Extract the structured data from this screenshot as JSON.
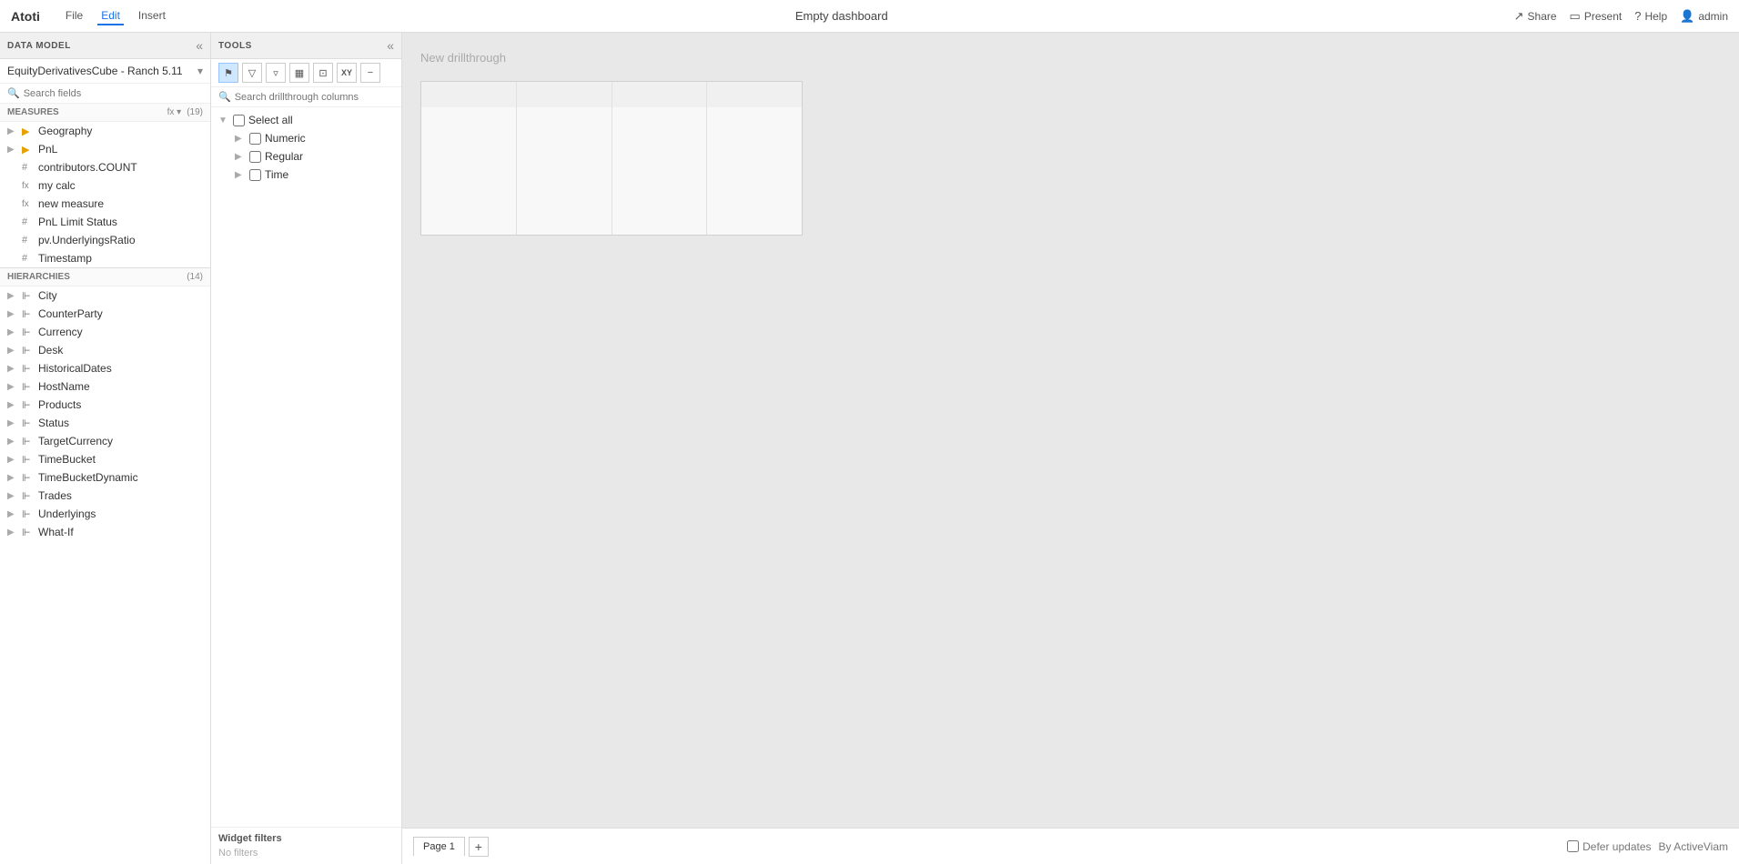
{
  "app": {
    "brand": "Atoti",
    "title": "Empty dashboard"
  },
  "topbar": {
    "menu": [
      "File",
      "Edit",
      "Insert"
    ],
    "active_menu": "Edit",
    "right_actions": [
      "Share",
      "Present",
      "Help",
      "admin"
    ]
  },
  "left_sidebar": {
    "section_title": "DATA MODEL",
    "cube": {
      "name": "EquityDerivativesCube",
      "version": "Ranch 5.11"
    },
    "search_placeholder": "Search fields",
    "measures": {
      "title": "MEASURES",
      "count": "19",
      "items": [
        {
          "type": "folder",
          "icon": "folder",
          "label": "Geography",
          "expandable": true
        },
        {
          "type": "folder",
          "icon": "folder",
          "label": "PnL",
          "expandable": true
        },
        {
          "type": "count",
          "icon": "#",
          "label": "contributors.COUNT"
        },
        {
          "type": "fx",
          "icon": "fx",
          "label": "my calc"
        },
        {
          "type": "fx",
          "icon": "fx",
          "label": "new measure"
        },
        {
          "type": "count",
          "icon": "#",
          "label": "PnL Limit Status"
        },
        {
          "type": "count",
          "icon": "#",
          "label": "pv.UnderlyingsRatio"
        },
        {
          "type": "count",
          "icon": "#",
          "label": "Timestamp"
        }
      ]
    },
    "hierarchies": {
      "title": "HIERARCHIES",
      "count": "14",
      "items": [
        "City",
        "CounterParty",
        "Currency",
        "Desk",
        "HistoricalDates",
        "HostName",
        "Products",
        "Status",
        "TargetCurrency",
        "TimeBucket",
        "TimeBucketDynamic",
        "Trades",
        "Underlyings",
        "What-If"
      ]
    }
  },
  "tools_panel": {
    "title": "TOOLS",
    "toolbar_buttons": [
      {
        "id": "filter1",
        "icon": "⚑",
        "title": "Filter"
      },
      {
        "id": "filter2",
        "icon": "▽",
        "title": "Filter down"
      },
      {
        "id": "filter3",
        "icon": "▿",
        "title": "Filter"
      },
      {
        "id": "bars",
        "icon": "⬛",
        "title": "Columns"
      },
      {
        "id": "scatter",
        "icon": "⊡",
        "title": "Scatter"
      },
      {
        "id": "xy",
        "icon": "XY",
        "title": "XY"
      },
      {
        "id": "minus",
        "icon": "−",
        "title": "Remove"
      }
    ],
    "search_placeholder": "Search drillthrough columns",
    "drillthrough": {
      "select_all": "Select all",
      "groups": [
        {
          "label": "Numeric",
          "expandable": true,
          "checked": false
        },
        {
          "label": "Regular",
          "expandable": true,
          "checked": false
        },
        {
          "label": "Time",
          "expandable": true,
          "checked": false
        }
      ]
    },
    "widget_filters": {
      "title": "Widget filters",
      "no_filters": "No filters"
    }
  },
  "canvas": {
    "drillthrough_label": "New drillthrough",
    "grid": {
      "header_cols": 4,
      "header_rows": 1,
      "data_rows": 4
    }
  },
  "page_bar": {
    "pages": [
      "Page 1"
    ],
    "active_page": "Page 1",
    "add_button": "+",
    "defer_updates": "Defer updates",
    "by_label": "By ActiveViam"
  },
  "icons": {
    "search": "🔍",
    "expand_right": "▶",
    "collapse_down": "▼",
    "folder": "📁",
    "hash": "#",
    "fx": "fx",
    "hierarchy": "⊩",
    "double_arrow_left": "«",
    "dropdown": "▾",
    "share": "↗",
    "present": "⬛",
    "help": "?",
    "user": "👤"
  }
}
